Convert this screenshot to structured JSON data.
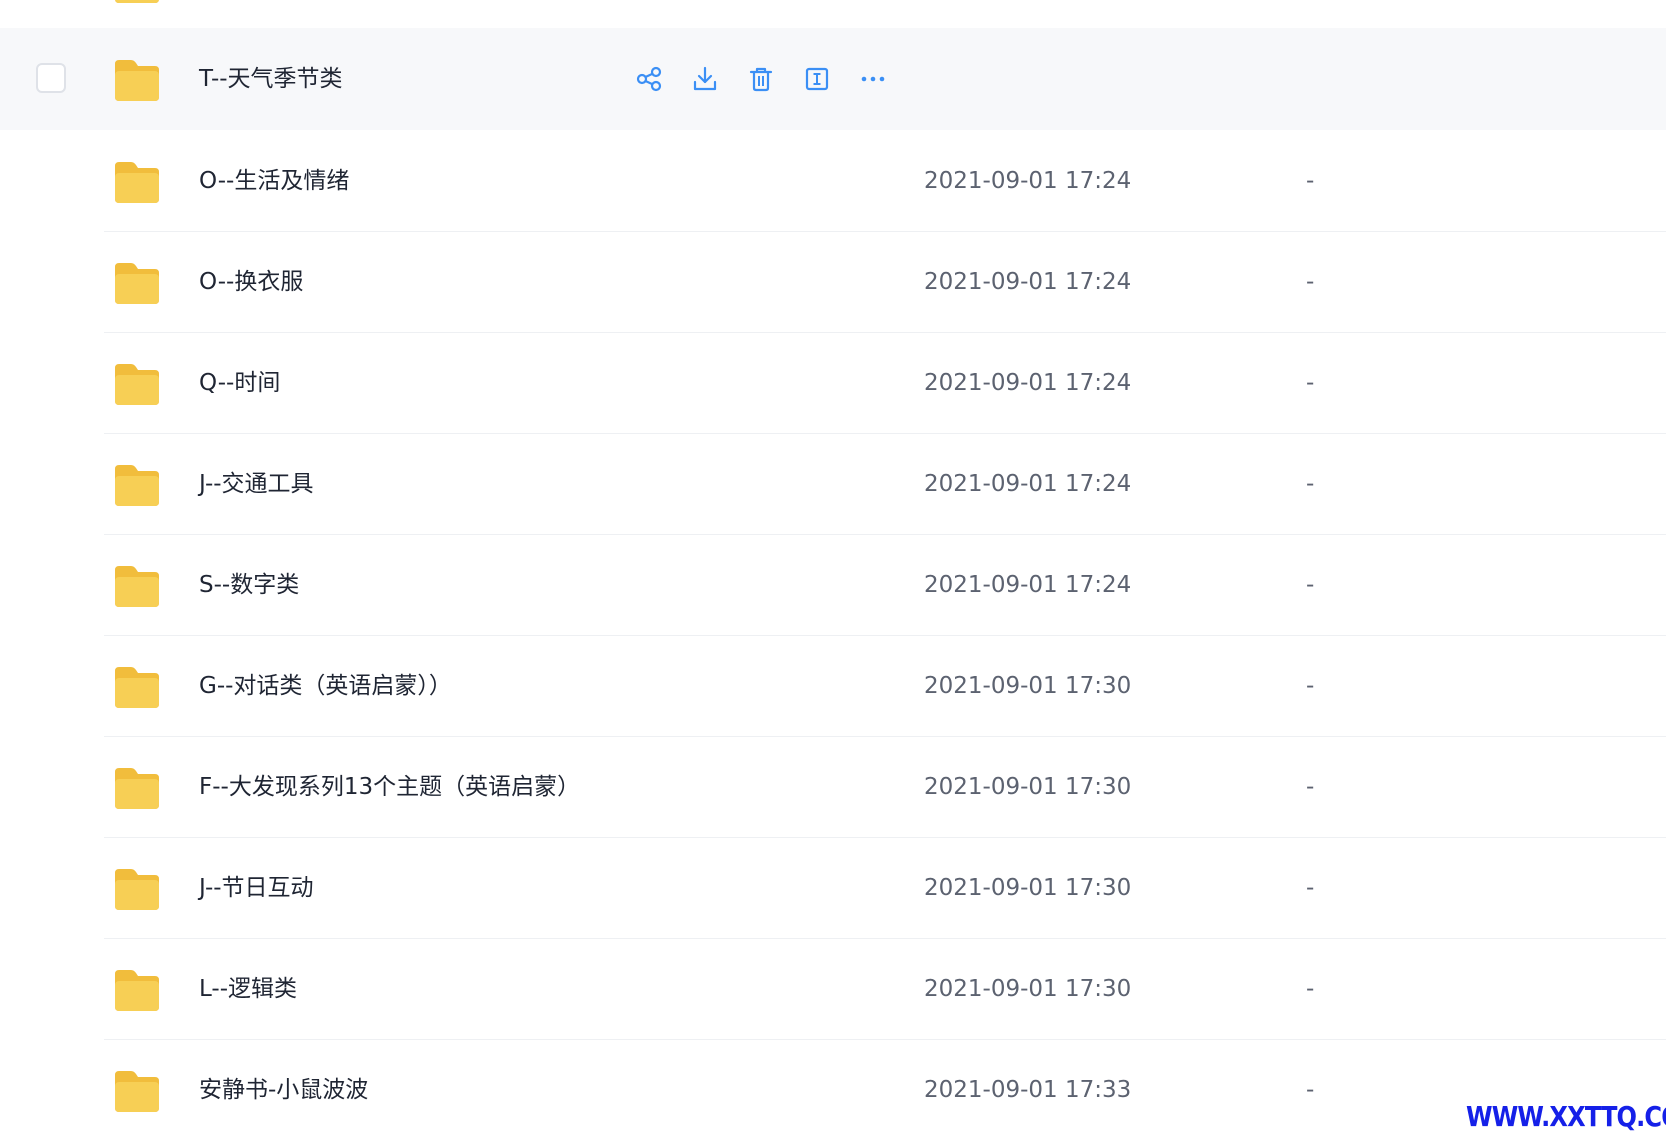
{
  "colors": {
    "folder": "#f7cf55",
    "action_icon": "#3b8ff5",
    "row_hover": "#f7f8fa",
    "watermark": "#1520e8"
  },
  "hover_row": {
    "name": "T--天气季节类",
    "actions": [
      {
        "icon": "share-icon"
      },
      {
        "icon": "download-icon"
      },
      {
        "icon": "delete-icon"
      },
      {
        "icon": "rename-icon"
      },
      {
        "icon": "more-icon"
      }
    ]
  },
  "rows": [
    {
      "name": "O--生活及情绪",
      "date": "2021-09-01 17:24",
      "size": "-"
    },
    {
      "name": "O--换衣服",
      "date": "2021-09-01 17:24",
      "size": "-"
    },
    {
      "name": "Q--时间",
      "date": "2021-09-01 17:24",
      "size": "-"
    },
    {
      "name": "J--交通工具",
      "date": "2021-09-01 17:24",
      "size": "-"
    },
    {
      "name": "S--数字类",
      "date": "2021-09-01 17:24",
      "size": "-"
    },
    {
      "name": "G--对话类（英语启蒙））",
      "date": "2021-09-01 17:30",
      "size": "-"
    },
    {
      "name": "F--大发现系列13个主题（英语启蒙）",
      "date": "2021-09-01 17:30",
      "size": "-"
    },
    {
      "name": "J--节日互动",
      "date": "2021-09-01 17:30",
      "size": "-"
    },
    {
      "name": "L--逻辑类",
      "date": "2021-09-01 17:30",
      "size": "-"
    },
    {
      "name": "安静书-小鼠波波",
      "date": "2021-09-01 17:33",
      "size": "-"
    }
  ],
  "watermark": "WWW.XXTTQ.COM"
}
